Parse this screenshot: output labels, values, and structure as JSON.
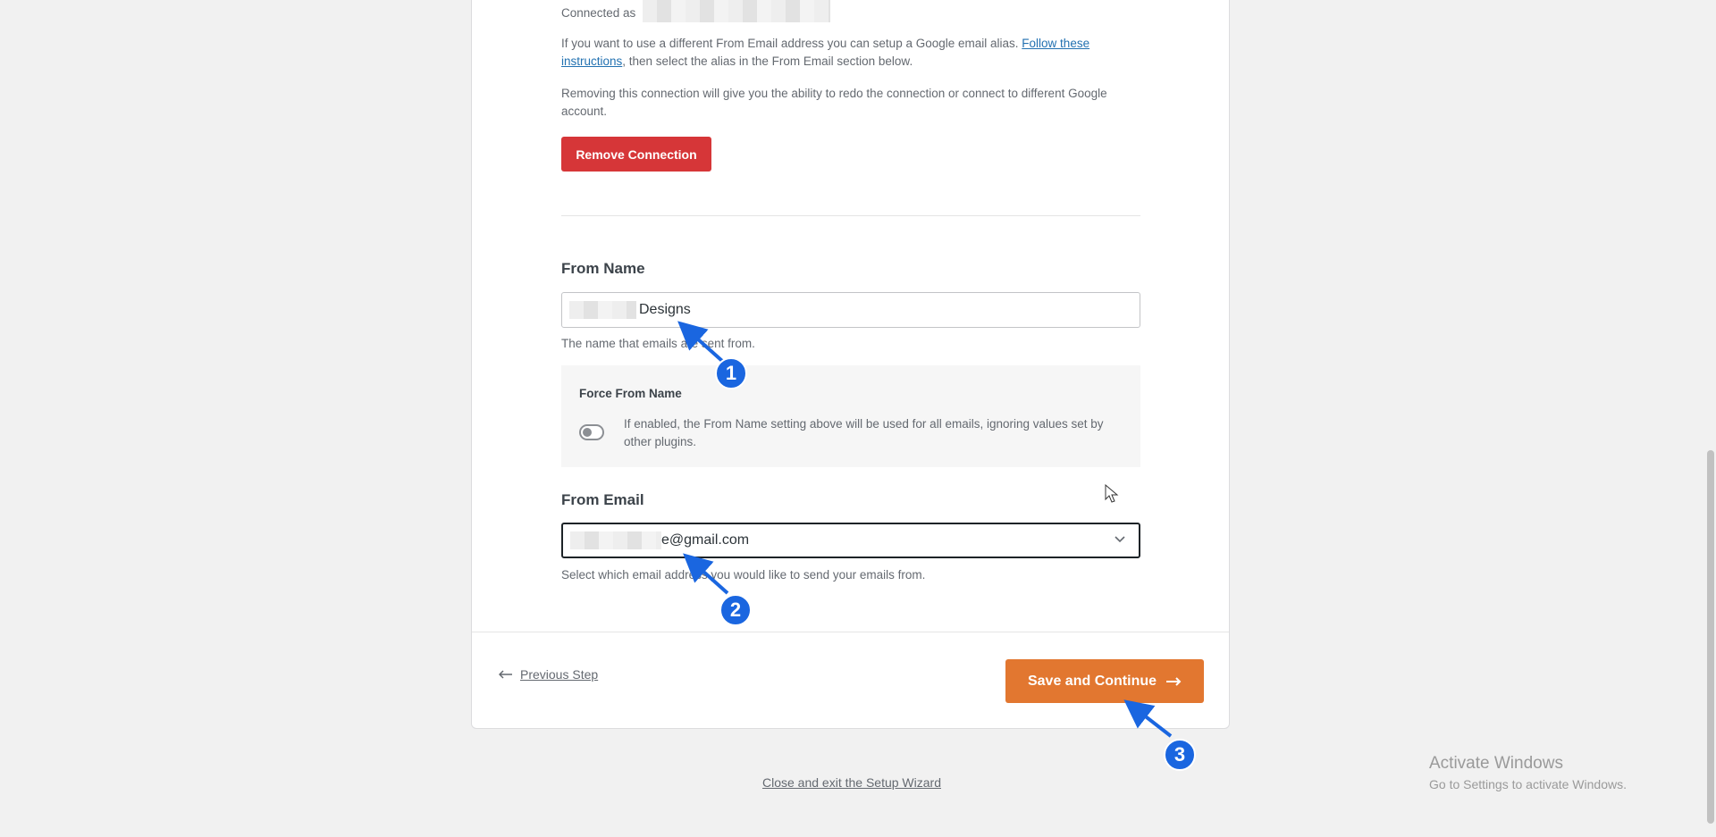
{
  "connection": {
    "connected_as_label": "Connected as",
    "alias_text_before": "If you want to use a different From Email address you can setup a Google email alias.",
    "alias_link": "Follow these instructions",
    "alias_text_after": ", then select the alias in the From Email section below.",
    "remove_text": "Removing this connection will give you the ability to redo the connection or connect to different Google account.",
    "remove_button": "Remove Connection"
  },
  "from_name": {
    "label": "From Name",
    "value": "Designs",
    "help": "The name that emails are sent from."
  },
  "force_from_name": {
    "label": "Force From Name",
    "description": "If enabled, the From Name setting above will be used for all emails, ignoring values set by other plugins.",
    "enabled": false
  },
  "from_email": {
    "label": "From Email",
    "value": "e@gmail.com",
    "help": "Select which email address you would like to send your emails from."
  },
  "footer": {
    "previous": "Previous Step",
    "save": "Save and Continue",
    "close": "Close and exit the Setup Wizard"
  },
  "annotations": [
    "1",
    "2",
    "3"
  ],
  "watermark": {
    "title": "Activate Windows",
    "subtitle": "Go to Settings to activate Windows."
  },
  "colors": {
    "remove": "#d63638",
    "save": "#e27730",
    "annotation": "#1a66e0",
    "link": "#2271b1"
  }
}
